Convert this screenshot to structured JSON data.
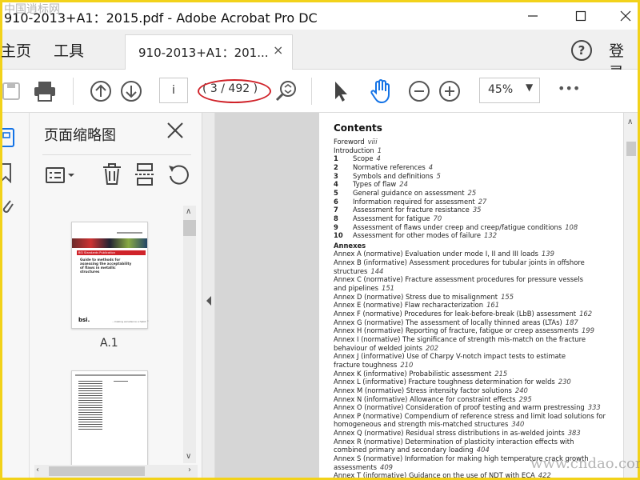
{
  "window": {
    "title": "910-2013+A1：2015.pdf - Adobe Acrobat Pro DC",
    "minimize_icon": "minimize-icon",
    "maximize_icon": "maximize-icon",
    "close_icon": "close-icon"
  },
  "menu": {
    "home": "主页",
    "tools": "工具",
    "login": "登录",
    "help_icon": "help-icon"
  },
  "doc_tab": {
    "label": "910-2013+A1：201...",
    "close": "×"
  },
  "toolbar": {
    "page_input": "i",
    "page_count": "( 3 / 492 )",
    "zoom": "45%",
    "zoom_arrow": "▼",
    "more": "•••",
    "accent": "#1473e6",
    "highlight_ring": "#d0232a"
  },
  "thumb_panel": {
    "title": "页面缩略图",
    "close": "✕",
    "thumb1_label": "A.1",
    "thumb1_banner": "BSI Standards Publication",
    "thumb1_heading": "Guide to methods for assessing the acceptability of flaws in metallic structures",
    "thumb1_brand": "bsi.",
    "thumb1_footer": "...making excellence a habit.™"
  },
  "document": {
    "heading": "Contents",
    "front": [
      {
        "label": "Foreword",
        "page": "viii"
      },
      {
        "label": "Introduction",
        "page": "1"
      }
    ],
    "sections": [
      {
        "num": "1",
        "label": "Scope",
        "page": "4"
      },
      {
        "num": "2",
        "label": "Normative references",
        "page": "4"
      },
      {
        "num": "3",
        "label": "Symbols and definitions",
        "page": "5"
      },
      {
        "num": "4",
        "label": "Types of flaw",
        "page": "24"
      },
      {
        "num": "5",
        "label": "General guidance on assessment",
        "page": "25"
      },
      {
        "num": "6",
        "label": "Information required for assessment",
        "page": "27"
      },
      {
        "num": "7",
        "label": "Assessment for fracture resistance",
        "page": "35"
      },
      {
        "num": "8",
        "label": "Assessment for fatigue",
        "page": "70"
      },
      {
        "num": "9",
        "label": "Assessment of flaws under creep and creep/fatigue conditions",
        "page": "108"
      },
      {
        "num": "10",
        "label": "Assessment for other modes of failure",
        "page": "132"
      }
    ],
    "annexes_heading": "Annexes",
    "annexes": [
      {
        "label": "Annex A (normative)  Evaluation under mode I, II and III loads",
        "page": "139"
      },
      {
        "label": "Annex B (informative)  Assessment procedures for tubular joints in offshore",
        "page": ""
      },
      {
        "label": "structures",
        "page": "144"
      },
      {
        "label": "Annex C (normative)  Fracture assessment procedures for pressure vessels",
        "page": ""
      },
      {
        "label": "and pipelines",
        "page": "151"
      },
      {
        "label": "Annex D (normative)  Stress due to misalignment",
        "page": "155"
      },
      {
        "label": "Annex E (normative)  Flaw recharacterization",
        "page": "161"
      },
      {
        "label": "Annex F (normative)  Procedures for leak-before-break (LbB) assessment",
        "page": "162"
      },
      {
        "label": "Annex G (normative)  The assessment of locally thinned areas (LTAs)",
        "page": "187"
      },
      {
        "label": "Annex H (normative)  Reporting of fracture, fatigue or creep assessments",
        "page": "199"
      },
      {
        "label": "Annex I (normative)  The significance of strength mis-match on the fracture",
        "page": ""
      },
      {
        "label": "behaviour of welded joints",
        "page": "202"
      },
      {
        "label": "Annex J (informative)  Use of Charpy V-notch impact tests to estimate",
        "page": ""
      },
      {
        "label": "fracture toughness",
        "page": "210"
      },
      {
        "label": "Annex K (informative)  Probabilistic assessment",
        "page": "215"
      },
      {
        "label": "Annex L (informative)  Fracture toughness determination for welds",
        "page": "230"
      },
      {
        "label": "Annex M (normative)  Stress intensity factor solutions",
        "page": "240"
      },
      {
        "label": "Annex N (informative)  Allowance for constraint effects",
        "page": "295"
      },
      {
        "label": "Annex O (normative)  Consideration of proof testing and warm prestressing",
        "page": "333"
      },
      {
        "label": "Annex P (normative)  Compendium of reference stress and limit load solutions for",
        "page": ""
      },
      {
        "label": "homogeneous and strength mis-matched structures",
        "page": "340"
      },
      {
        "label": "Annex Q (normative)  Residual stress distributions in as-welded joints",
        "page": "383"
      },
      {
        "label": "Annex R (normative)  Determination of plasticity interaction effects with",
        "page": ""
      },
      {
        "label": "combined primary and secondary loading",
        "page": "404"
      },
      {
        "label": "Annex S (normative)  Information for making high temperature crack growth",
        "page": ""
      },
      {
        "label": "assessments",
        "page": "409"
      },
      {
        "label": "Annex T (informative)  Guidance on the use of NDT with ECA",
        "page": "422"
      }
    ]
  },
  "watermarks": {
    "top_left": "中国逍标网",
    "bottom_right": "www.cndao.com"
  }
}
